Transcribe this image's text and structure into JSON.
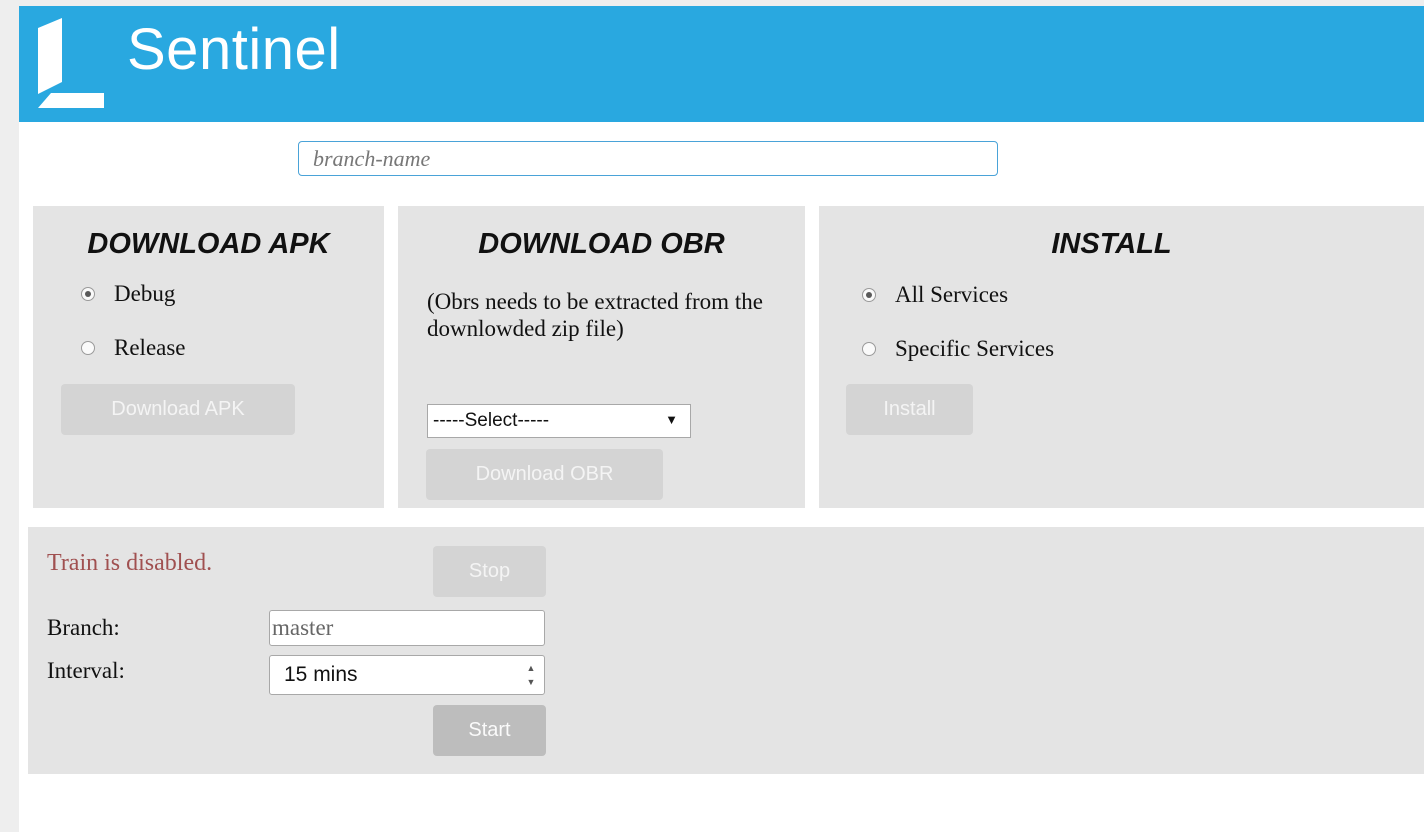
{
  "header": {
    "app_name": "Sentinel"
  },
  "search": {
    "placeholder": "branch-name"
  },
  "download_apk": {
    "title": "DOWNLOAD APK",
    "options": [
      "Debug",
      "Release"
    ],
    "selected": "Debug",
    "button_label": "Download APK"
  },
  "download_obr": {
    "title": "DOWNLOAD OBR",
    "note": "(Obrs needs to be extracted from the downlowded zip file)",
    "select_value": "-----Select-----",
    "button_label": "Download OBR"
  },
  "install": {
    "title": "INSTALL",
    "options": [
      "All Services",
      "Specific Services"
    ],
    "selected": "All Services",
    "button_label": "Install"
  },
  "train": {
    "status": "Train is disabled.",
    "stop_label": "Stop",
    "branch_label": "Branch:",
    "branch_value": "master",
    "interval_label": "Interval:",
    "interval_value": "15 mins",
    "start_label": "Start"
  },
  "colors": {
    "header": "#29a8e0",
    "panel": "#e4e4e4",
    "status_text": "#a05050",
    "disabled_button": "#d4d4d4",
    "start_button": "#bdbdbd"
  },
  "icons": {
    "logo": "sentinel-logo-icon",
    "select_arrow": "chevron-down-icon",
    "spinner": "spinner-arrows-icon"
  }
}
